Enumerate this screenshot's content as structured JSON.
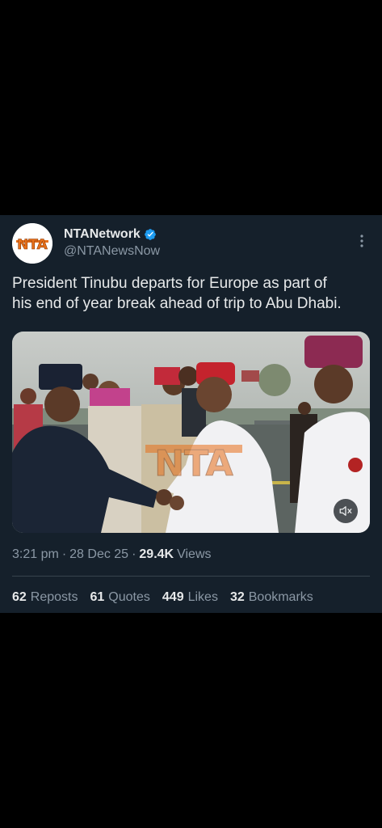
{
  "tweet": {
    "author": {
      "display_name": "NTANetwork",
      "handle": "@NTANewsNow",
      "verified": true,
      "avatar_logo": "NTA"
    },
    "text": "President Tinubu departs for Europe as part of\nhis end of year break ahead of trip to Abu Dhabi.",
    "media": {
      "type": "video",
      "watermark": "NTA",
      "mute_icon": "speaker-muted-icon"
    },
    "time": "3:21 pm",
    "date": "28 Dec 25",
    "views_count": "29.4K",
    "views_label": "Views",
    "stats": {
      "reposts": {
        "count": "62",
        "label": "Reposts"
      },
      "quotes": {
        "count": "61",
        "label": "Quotes"
      },
      "likes": {
        "count": "449",
        "label": "Likes"
      },
      "bookmarks": {
        "count": "32",
        "label": "Bookmarks"
      }
    }
  },
  "colors": {
    "page_background": "#000000",
    "card_background": "#15202b",
    "primary_text": "#e7e9ea",
    "secondary_text": "#8b98a5",
    "verified_blue": "#1d9bf0",
    "divider": "#38444d",
    "logo_orange": "#e8701a"
  }
}
